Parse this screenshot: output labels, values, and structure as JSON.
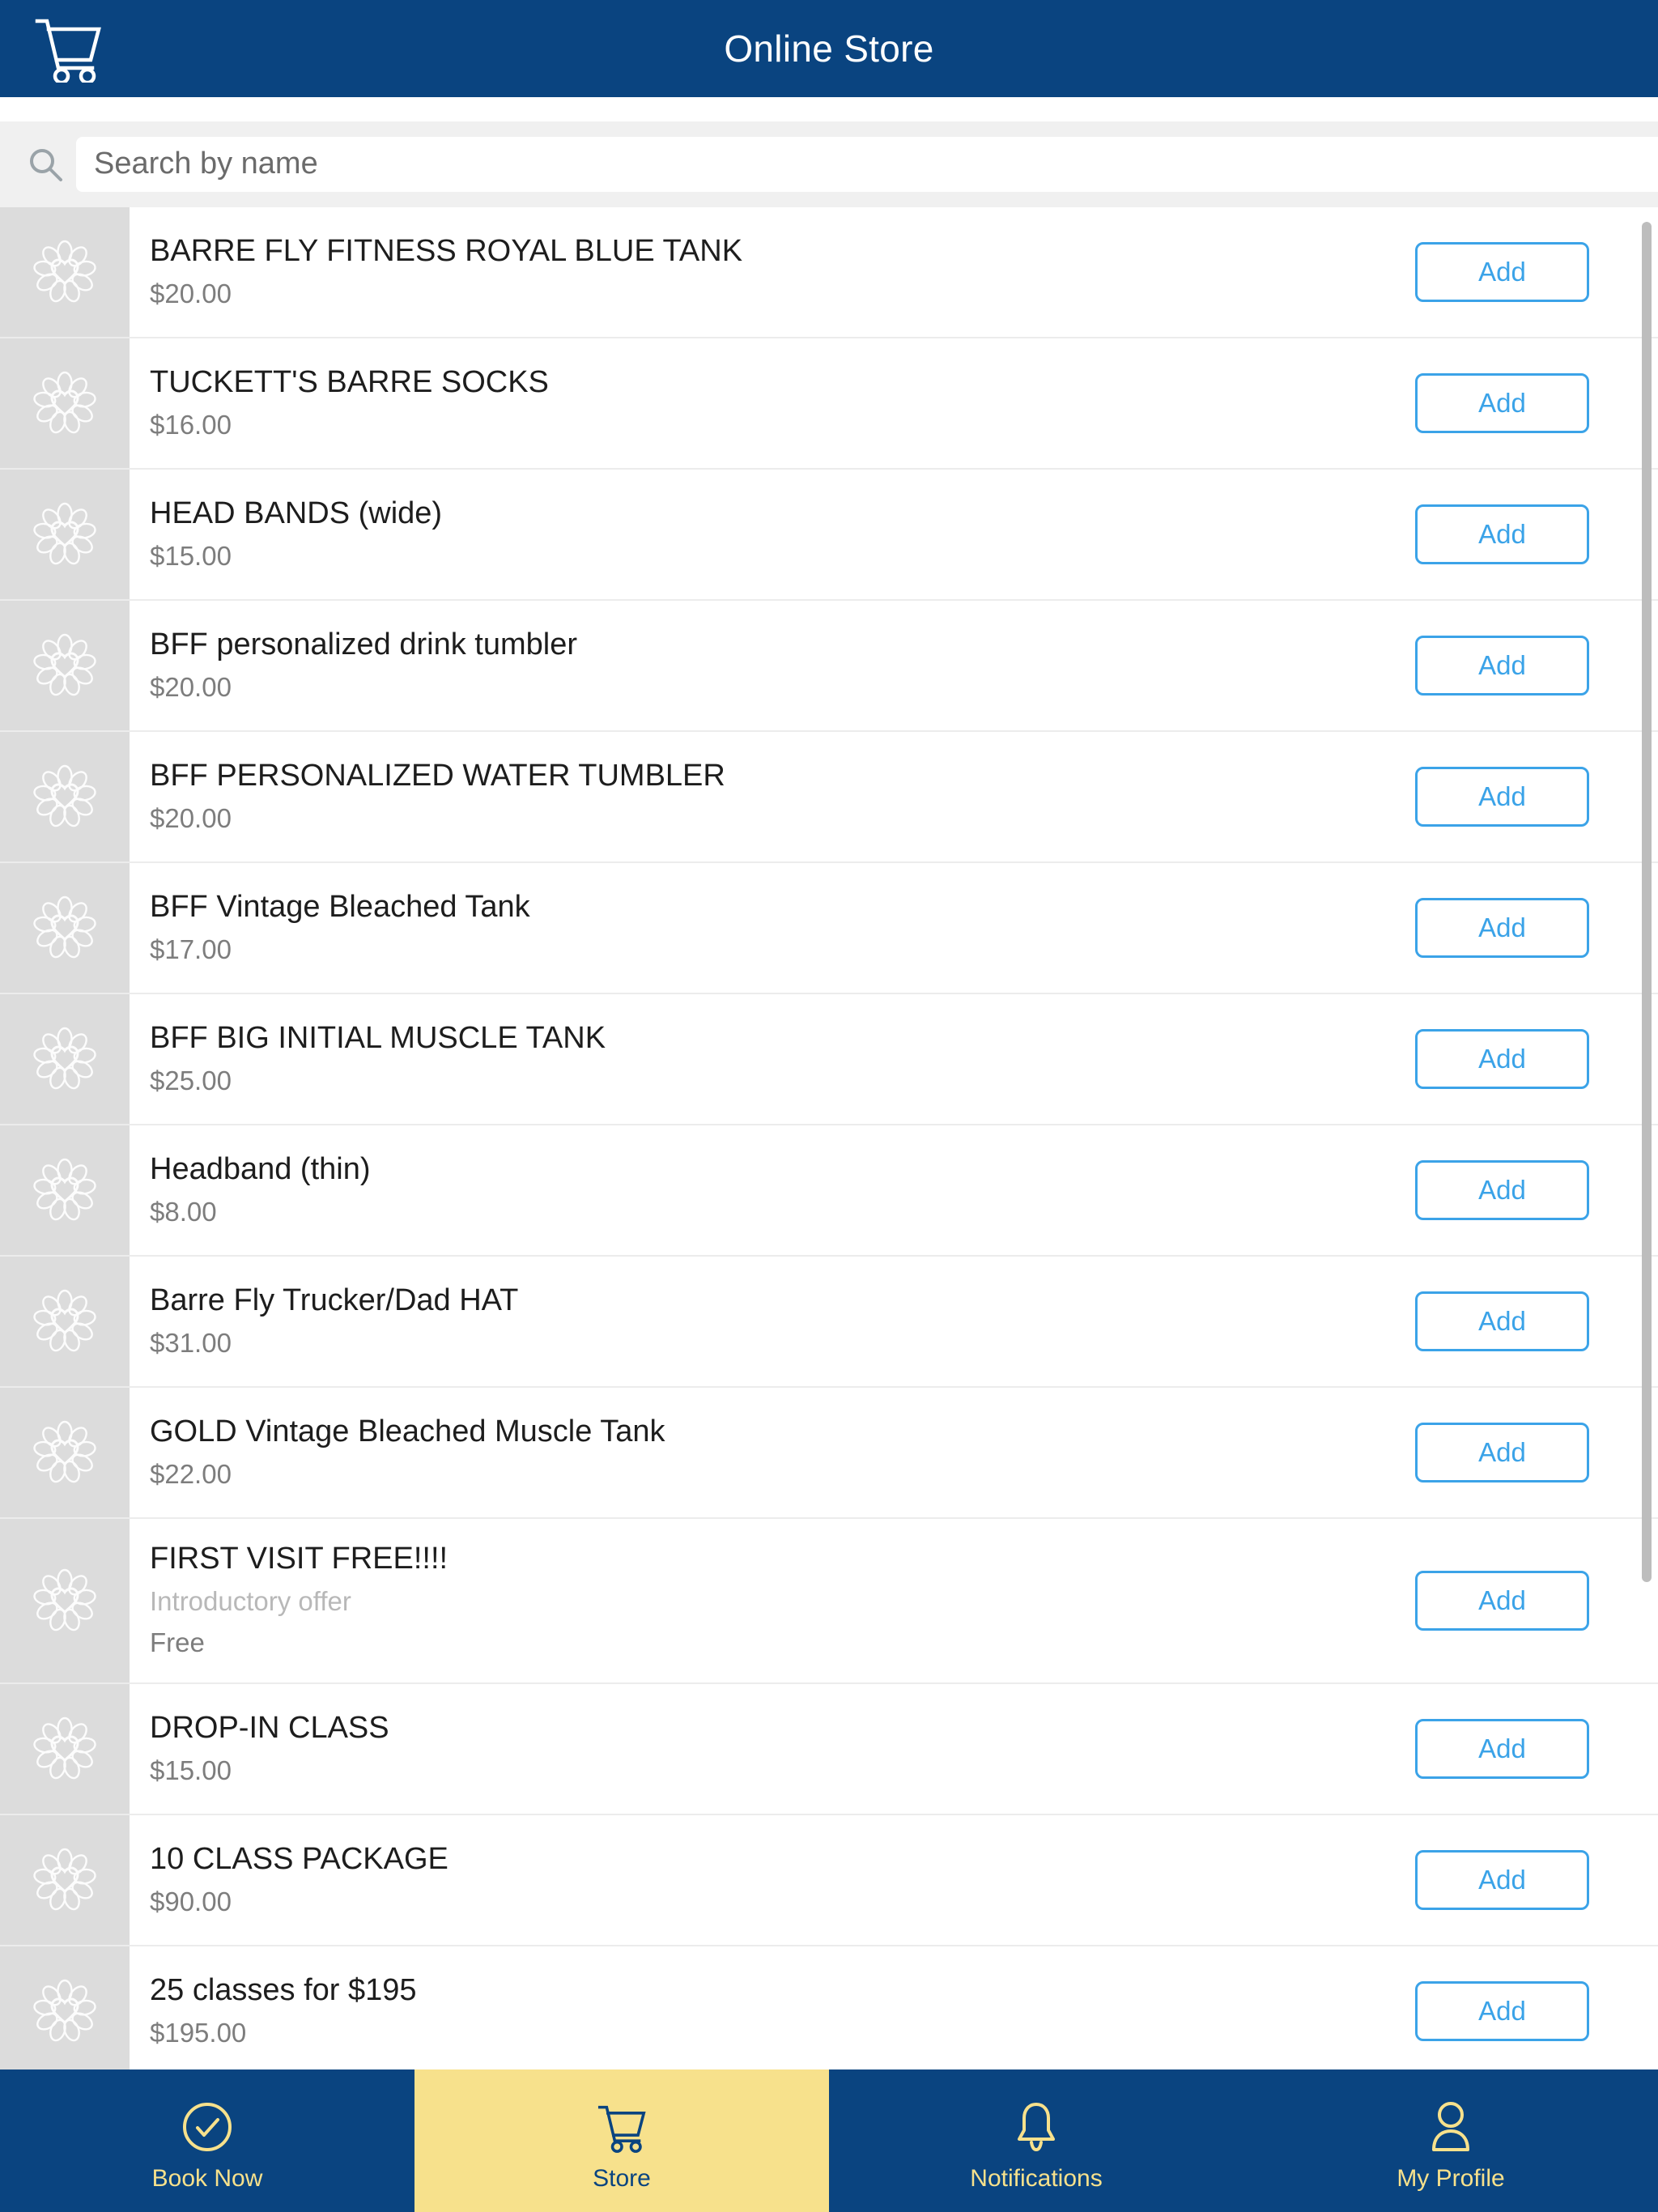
{
  "header": {
    "title": "Online Store",
    "cart_icon": "shopping-cart-icon"
  },
  "search": {
    "placeholder": "Search by name",
    "value": "",
    "icon": "search-icon"
  },
  "products": [
    {
      "name": "BARRE FLY FITNESS ROYAL BLUE TANK",
      "sub": "",
      "price": "$20.00",
      "add_label": "Add"
    },
    {
      "name": "TUCKETT'S BARRE SOCKS",
      "sub": "",
      "price": "$16.00",
      "add_label": "Add"
    },
    {
      "name": "HEAD BANDS (wide)",
      "sub": "",
      "price": "$15.00",
      "add_label": "Add"
    },
    {
      "name": "BFF personalized drink tumbler",
      "sub": "",
      "price": "$20.00",
      "add_label": "Add"
    },
    {
      "name": "BFF PERSONALIZED WATER TUMBLER",
      "sub": "",
      "price": "$20.00",
      "add_label": "Add"
    },
    {
      "name": "BFF Vintage Bleached Tank",
      "sub": "",
      "price": "$17.00",
      "add_label": "Add"
    },
    {
      "name": "BFF BIG INITIAL MUSCLE TANK",
      "sub": "",
      "price": "$25.00",
      "add_label": "Add"
    },
    {
      "name": "Headband (thin)",
      "sub": "",
      "price": "$8.00",
      "add_label": "Add"
    },
    {
      "name": "Barre Fly Trucker/Dad HAT",
      "sub": "",
      "price": "$31.00",
      "add_label": "Add"
    },
    {
      "name": "GOLD Vintage Bleached Muscle Tank",
      "sub": "",
      "price": "$22.00",
      "add_label": "Add"
    },
    {
      "name": "FIRST VISIT FREE!!!!",
      "sub": "Introductory offer",
      "price": "Free",
      "add_label": "Add"
    },
    {
      "name": "DROP-IN CLASS",
      "sub": "",
      "price": "$15.00",
      "add_label": "Add"
    },
    {
      "name": "10 CLASS PACKAGE",
      "sub": "",
      "price": "$90.00",
      "add_label": "Add"
    },
    {
      "name": "25 classes for $195",
      "sub": "",
      "price": "$195.00",
      "add_label": "Add"
    }
  ],
  "nav": {
    "items": [
      {
        "label": "Book Now",
        "icon": "check-circle-icon",
        "active": false
      },
      {
        "label": "Store",
        "icon": "shopping-cart-icon",
        "active": true
      },
      {
        "label": "Notifications",
        "icon": "bell-icon",
        "active": false
      },
      {
        "label": "My Profile",
        "icon": "person-icon",
        "active": false
      }
    ]
  },
  "colors": {
    "brand_blue": "#0a4480",
    "accent_yellow": "#f7e18c",
    "add_button_blue": "#3ba3e8",
    "thumb_bg": "#dcdcdc",
    "search_bg": "#f0f0f0"
  }
}
